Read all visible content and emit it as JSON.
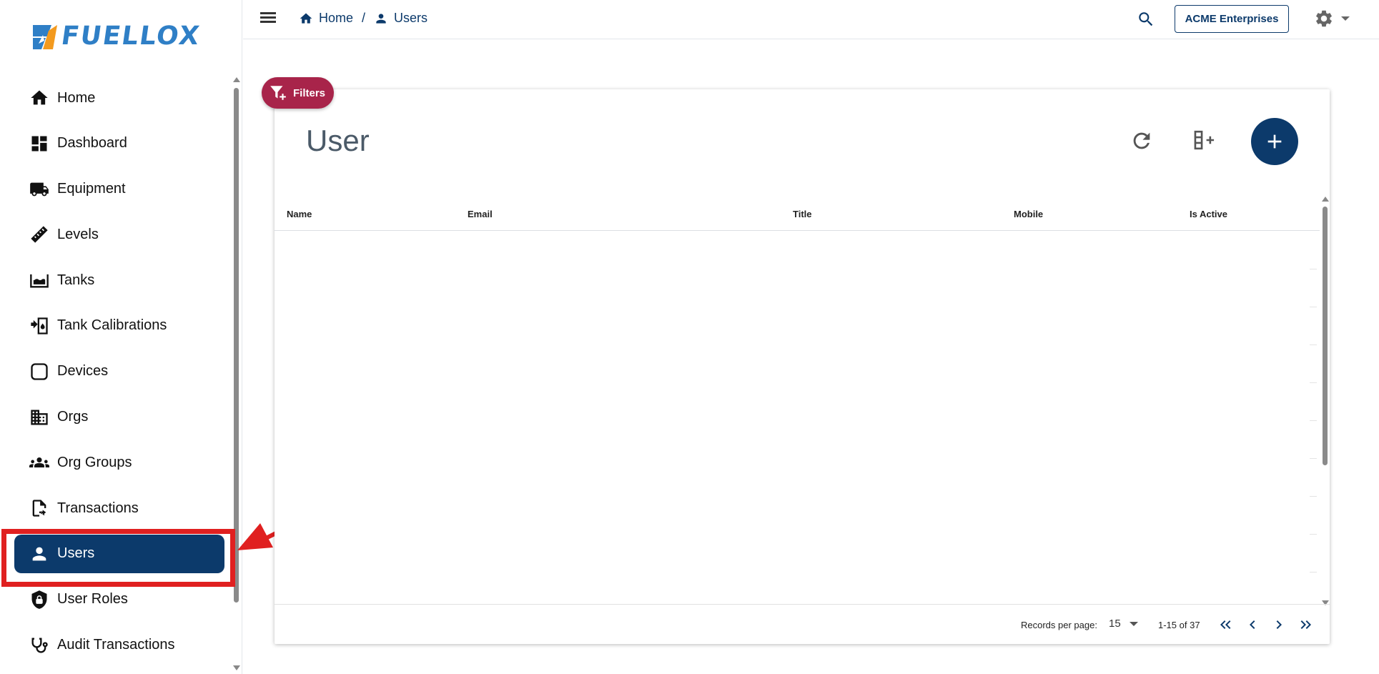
{
  "brand": {
    "logo_text": "FUELLOX"
  },
  "sidebar": {
    "items": [
      {
        "label": "Home",
        "icon": "home-icon"
      },
      {
        "label": "Dashboard",
        "icon": "dashboard-icon"
      },
      {
        "label": "Equipment",
        "icon": "truck-icon"
      },
      {
        "label": "Levels",
        "icon": "ruler-icon"
      },
      {
        "label": "Tanks",
        "icon": "tank-icon"
      },
      {
        "label": "Tank Calibrations",
        "icon": "calibration-icon"
      },
      {
        "label": "Devices",
        "icon": "device-icon"
      },
      {
        "label": "Orgs",
        "icon": "building-icon"
      },
      {
        "label": "Org Groups",
        "icon": "groups-icon"
      },
      {
        "label": "Transactions",
        "icon": "transactions-icon"
      },
      {
        "label": "Users",
        "icon": "user-icon",
        "active": true
      },
      {
        "label": "User Roles",
        "icon": "shield-lock-icon"
      },
      {
        "label": "Audit Transactions",
        "icon": "stethoscope-icon"
      }
    ]
  },
  "topbar": {
    "breadcrumb": {
      "home": "Home",
      "separator": "/",
      "current": "Users"
    },
    "org_button": "ACME Enterprises"
  },
  "filters_label": "Filters",
  "card": {
    "title": "User",
    "columns": [
      "Name",
      "Email",
      "Title",
      "Mobile",
      "Is Active"
    ]
  },
  "pagination": {
    "records_per_page_label": "Records per page:",
    "records_per_page": "15",
    "range_text": "1-15 of 37"
  },
  "colors": {
    "primary": "#0c3a6b",
    "filters": "#a8244a",
    "annotation": "#e02020"
  }
}
